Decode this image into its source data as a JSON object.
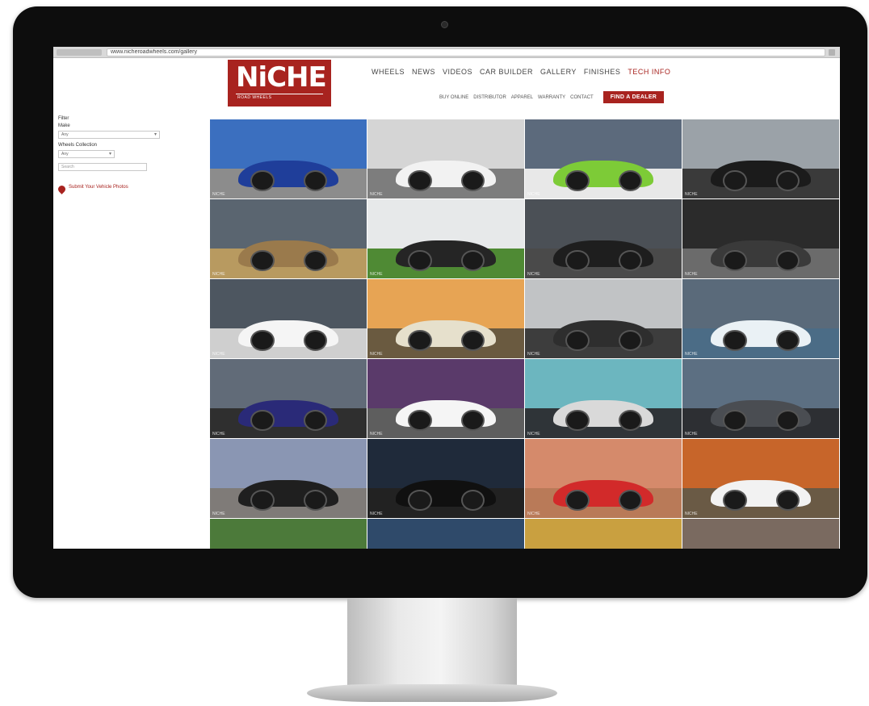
{
  "browser": {
    "url": "www.nicheroadwheels.com/gallery"
  },
  "header": {
    "logo_text": "NiCHE",
    "logo_subtext": "ROAD WHEELS",
    "nav": [
      {
        "label": "WHEELS"
      },
      {
        "label": "NEWS"
      },
      {
        "label": "VIDEOS"
      },
      {
        "label": "CAR BUILDER"
      },
      {
        "label": "GALLERY"
      },
      {
        "label": "FINISHES"
      },
      {
        "label": "TECH INFO"
      }
    ],
    "subnav": [
      {
        "label": "BUY ONLINE"
      },
      {
        "label": "DISTRIBUTOR"
      },
      {
        "label": "APPAREL"
      },
      {
        "label": "WARRANTY"
      },
      {
        "label": "CONTACT"
      }
    ],
    "dealer_button": "FIND A DEALER"
  },
  "sidebar": {
    "filters_title": "Filter",
    "make_label": "Make",
    "make_value": "Any",
    "wheel_label": "Wheels Collection",
    "wheel_value": "Any",
    "search_placeholder": "Search",
    "link_label": "Submit Your Vehicle Photos"
  },
  "gallery": {
    "watermark": "NICHE",
    "tiles": [
      {
        "name": "blue-coupe",
        "sky": "#3b6fbf",
        "ground": "#8c8c8c",
        "car": "#1f3e9a"
      },
      {
        "name": "white-sedan-hyperdrive",
        "sky": "#d5d5d5",
        "ground": "#7d7d7d",
        "car": "#f2f2f2"
      },
      {
        "name": "green-gtr",
        "sky": "#5c6a7c",
        "ground": "#e8e8e8",
        "car": "#7dcb37"
      },
      {
        "name": "black-sedan-showroom",
        "sky": "#9ba2a8",
        "ground": "#3a3a3a",
        "car": "#1b1b1b"
      },
      {
        "name": "bronze-coupe",
        "sky": "#5a6570",
        "ground": "#b89a60",
        "car": "#9a7a4c"
      },
      {
        "name": "black-suv-grass",
        "sky": "#e7e9ea",
        "ground": "#4f8a34",
        "car": "#252525"
      },
      {
        "name": "black-range-rover",
        "sky": "#4b5056",
        "ground": "#4a4a4a",
        "car": "#1e1e1e"
      },
      {
        "name": "grey-audi-suv",
        "sky": "#2b2b2b",
        "ground": "#6b6b6b",
        "car": "#3a3a3a"
      },
      {
        "name": "white-ford-fusion",
        "sky": "#4d5660",
        "ground": "#cfcfcf",
        "car": "#f5f5f5"
      },
      {
        "name": "white-sedan-sunset",
        "sky": "#e7a454",
        "ground": "#6a5a40",
        "car": "#e6e0cc"
      },
      {
        "name": "dark-sedan-garage",
        "sky": "#c1c3c5",
        "ground": "#3d3d3d",
        "car": "#2e2e2e"
      },
      {
        "name": "white-mustang-bridge",
        "sky": "#5a6a7a",
        "ground": "#4b6c86",
        "car": "#eaf1f5"
      },
      {
        "name": "blue-sports-coupe",
        "sky": "#616b78",
        "ground": "#2f2f2f",
        "car": "#2a2a78"
      },
      {
        "name": "white-explorer",
        "sky": "#5a3a6a",
        "ground": "#5e5e5e",
        "car": "#f5f5f5"
      },
      {
        "name": "silver-supra",
        "sky": "#6cb6bf",
        "ground": "#2f3438",
        "car": "#d9d9d9"
      },
      {
        "name": "grey-cayenne",
        "sky": "#5c6f82",
        "ground": "#2d2f33",
        "car": "#4a4d52"
      },
      {
        "name": "black-car-desert",
        "sky": "#8a96b3",
        "ground": "#7f7b78",
        "car": "#1f1f1f"
      },
      {
        "name": "black-lexus",
        "sky": "#1f2a3a",
        "ground": "#222222",
        "car": "#101010"
      },
      {
        "name": "red-slingshot",
        "sky": "#d58a6b",
        "ground": "#b97a58",
        "car": "#d22a2a"
      },
      {
        "name": "white-mustang-autumn",
        "sky": "#c7652a",
        "ground": "#6a5a45",
        "car": "#f2f2f2"
      }
    ]
  }
}
